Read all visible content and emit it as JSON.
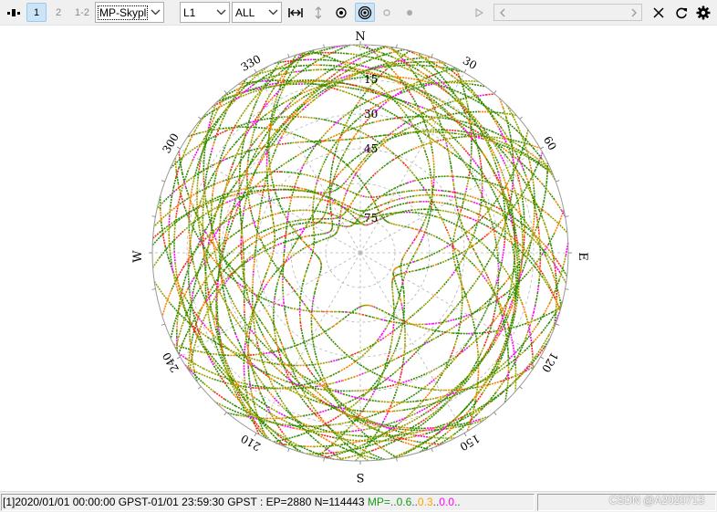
{
  "toolbar": {
    "plot_index_1": "1",
    "plot_index_2": "2",
    "plot_index_12": "1-2",
    "plot_type": "MP-Skyplot",
    "frequency": "L1",
    "satellite": "ALL"
  },
  "skyplot": {
    "directions": {
      "north": "N",
      "east": "E",
      "south": "S",
      "west": "W"
    },
    "azimuth_labels": [
      "30",
      "60",
      "120",
      "150",
      "210",
      "240",
      "300",
      "330"
    ],
    "elevation_labels": [
      "15",
      "30",
      "45",
      "75"
    ],
    "colors": {
      "green": "#2e8b00",
      "olive": "#9aa000",
      "orange": "#ff7f00",
      "red": "#ff2020",
      "magenta": "#ff00ff"
    }
  },
  "status": {
    "main": "[1]2020/01/01 00:00:00 GPST-01/01 23:59:30 GPST : EP=2880 N=114443",
    "mp_label": "MP=",
    "mp_dots1": "..",
    "mp_val1": "0.6",
    "mp_dots2": "..",
    "mp_val2": "0.3",
    "mp_dots3": "..",
    "mp_val3": "0.0",
    "mp_dots4": ".."
  },
  "watermark": "CSDN @A2020713"
}
